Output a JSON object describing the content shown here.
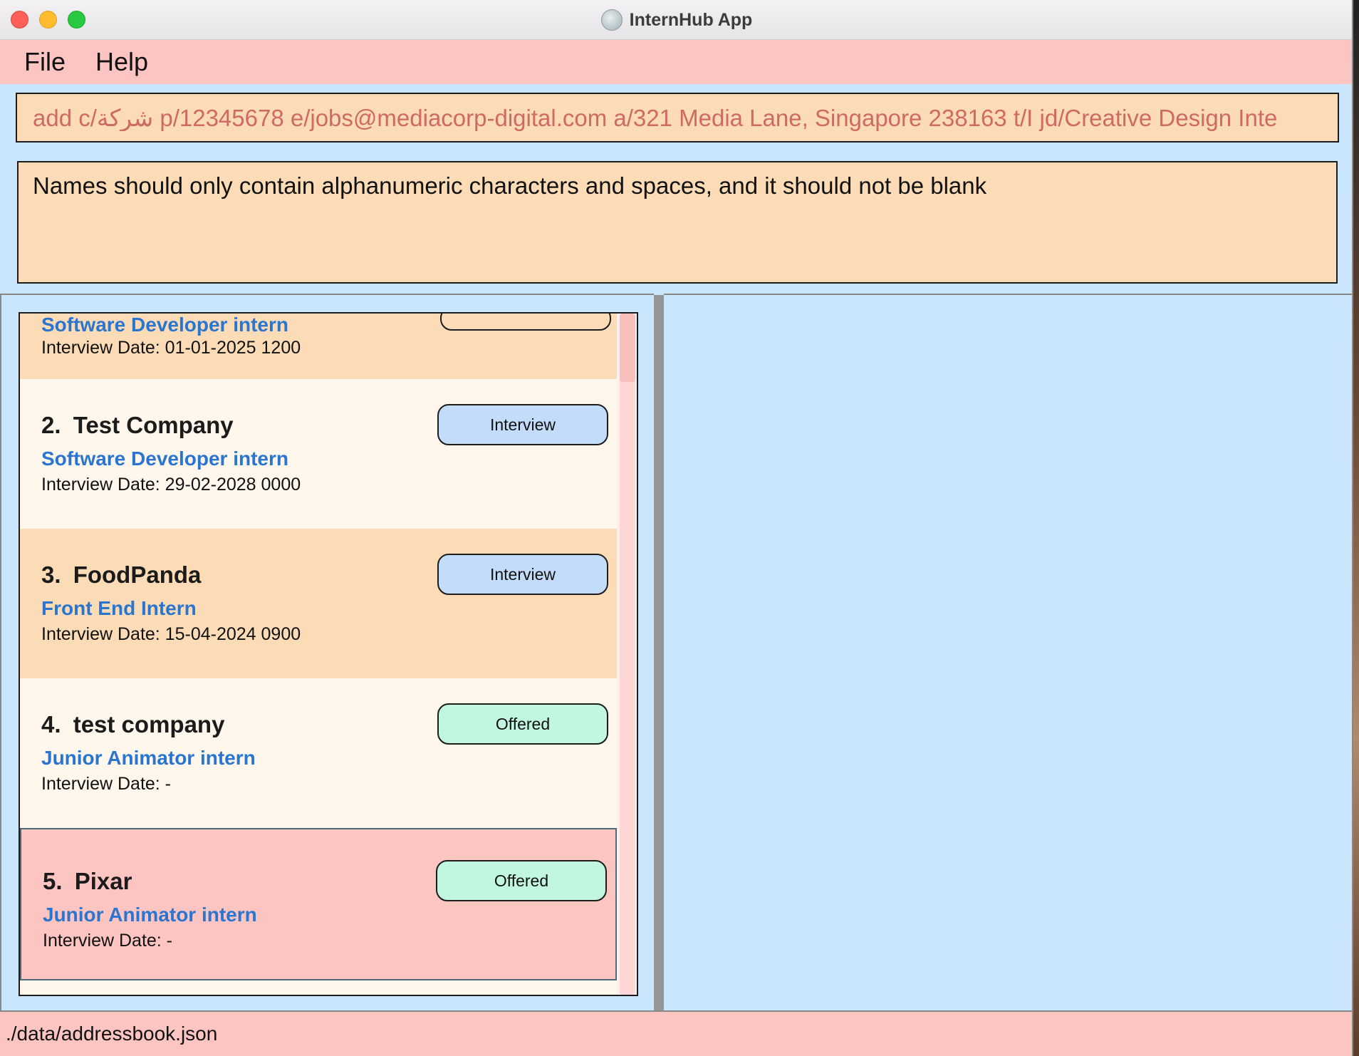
{
  "window": {
    "title": "InternHub App",
    "icon": "app-icon"
  },
  "menu": {
    "items": [
      {
        "label": "File"
      },
      {
        "label": "Help"
      }
    ]
  },
  "command": {
    "value": "add c/شركة p/12345678 e/jobs@mediacorp-digital.com a/321 Media Lane, Singapore 238163 t/I jd/Creative Design Inte"
  },
  "result": {
    "message": "Names should only contain alphanumeric characters and spaces, and it should not be blank"
  },
  "list": {
    "partial_card": {
      "role": "Software Developer intern",
      "interview_date": "Interview Date: 01-01-2025 1200"
    },
    "cards": [
      {
        "index": "2.",
        "company": "Test Company",
        "role": "Software Developer intern",
        "interview_date": "Interview Date: 29-02-2028 0000",
        "status": "Interview"
      },
      {
        "index": "3.",
        "company": "FoodPanda",
        "role": "Front End Intern",
        "interview_date": "Interview Date: 15-04-2024 0900",
        "status": "Interview"
      },
      {
        "index": "4.",
        "company": "test company",
        "role": "Junior Animator intern",
        "interview_date": "Interview Date: -",
        "status": "Offered"
      },
      {
        "index": "5.",
        "company": "Pixar",
        "role": "Junior Animator intern",
        "interview_date": "Interview Date: -",
        "status": "Offered"
      }
    ]
  },
  "statusbar": {
    "path": "./data/addressbook.json"
  },
  "colors": {
    "menu_bg": "#fcc5c2",
    "panel_bg": "#c9e6fc",
    "card_odd": "#fcdcb6",
    "card_even": "#fff6ec",
    "card_selected": "#fcc5c2",
    "interview_badge": "#c2dcfa",
    "offered_badge": "#c1f6df",
    "role_text": "#2a75d0",
    "command_text": "#cf6a62"
  }
}
